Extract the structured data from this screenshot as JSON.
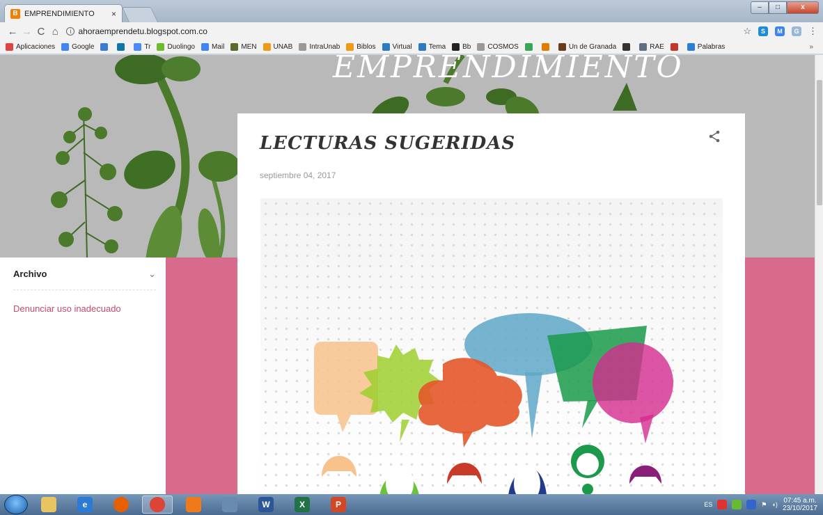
{
  "browser": {
    "tab_title": "EMPRENDIMIENTO",
    "tab_close": "×",
    "url": "ahoraemprendetu.blogspot.com.co",
    "nav": {
      "back": "←",
      "forward": "→",
      "reload": "C",
      "home": "⌂"
    },
    "window_buttons": {
      "minimize": "–",
      "maximize": "□",
      "close": "x"
    },
    "right_icons": {
      "star": "☆",
      "ext1": "S",
      "ext2": "M",
      "ext3": "G",
      "menu": "⋮"
    }
  },
  "bookmarks": {
    "items": [
      {
        "label": "Aplicaciones",
        "icon": "apps-grid-icon",
        "color": "#d44"
      },
      {
        "label": "Google",
        "icon": "google-icon",
        "color": "#4285f4"
      },
      {
        "label": "",
        "icon": "app-icon",
        "color": "#3b7bd4"
      },
      {
        "label": "",
        "icon": "linkedin-icon",
        "color": "#0e76a8"
      },
      {
        "label": "Tr",
        "icon": "translate-icon",
        "color": "#4a8af4"
      },
      {
        "label": "Duolingo",
        "icon": "duolingo-icon",
        "color": "#6fbb2e"
      },
      {
        "label": "Mail",
        "icon": "google-icon",
        "color": "#4285f4"
      },
      {
        "label": "MEN",
        "icon": "men-icon",
        "color": "#5a6a2e"
      },
      {
        "label": "UNAB",
        "icon": "unab-icon",
        "color": "#f09a1a"
      },
      {
        "label": "IntraUnab",
        "icon": "page-icon",
        "color": "#999999"
      },
      {
        "label": "Biblos",
        "icon": "unab-icon",
        "color": "#f09a1a"
      },
      {
        "label": "Virtual",
        "icon": "unab-icon",
        "color": "#2b7bc0"
      },
      {
        "label": "Tema",
        "icon": "unab-icon",
        "color": "#2b7bc0"
      },
      {
        "label": "Bb",
        "icon": "blackboard-icon",
        "color": "#222222"
      },
      {
        "label": "COSMOS",
        "icon": "page-icon",
        "color": "#999999"
      },
      {
        "label": "",
        "icon": "app-icon",
        "color": "#3aa655"
      },
      {
        "label": "",
        "icon": "app-icon",
        "color": "#e07b00"
      },
      {
        "label": "Un de Granada",
        "icon": "granada-icon",
        "color": "#6b3b1e"
      },
      {
        "label": "",
        "icon": "wikipedia-icon",
        "color": "#333333"
      },
      {
        "label": "RAE",
        "icon": "rae-icon",
        "color": "#607080"
      },
      {
        "label": "",
        "icon": "app-icon",
        "color": "#c0392b"
      },
      {
        "label": "Palabras",
        "icon": "chart-icon",
        "color": "#2a7fd4"
      }
    ],
    "more": "»"
  },
  "blog": {
    "header_title": "EMPRENDIMIENTO",
    "sidebar": {
      "archive_label": "Archivo",
      "archive_chevron": "⌄",
      "report_link": "Denunciar uso inadecuado"
    },
    "post": {
      "title": "LECTURAS SUGERIDAS",
      "date": "septiembre 04, 2017"
    }
  },
  "taskbar": {
    "apps": [
      {
        "name": "file-explorer",
        "label": "",
        "color": "#e8c560"
      },
      {
        "name": "internet-explorer",
        "label": "e",
        "color": "#2b7bd6"
      },
      {
        "name": "firefox",
        "label": "",
        "color": "#e66000"
      },
      {
        "name": "chrome",
        "label": "",
        "color": "#db4437"
      },
      {
        "name": "media",
        "label": "",
        "color": "#f07a1a"
      },
      {
        "name": "notepad",
        "label": "",
        "color": "#6a8bb0"
      },
      {
        "name": "word",
        "label": "W",
        "color": "#2b579a"
      },
      {
        "name": "excel",
        "label": "X",
        "color": "#217346"
      },
      {
        "name": "powerpoint",
        "label": "P",
        "color": "#d24726"
      }
    ],
    "language": "ES",
    "time": "07:45 a.m.",
    "date": "23/10/2017"
  }
}
